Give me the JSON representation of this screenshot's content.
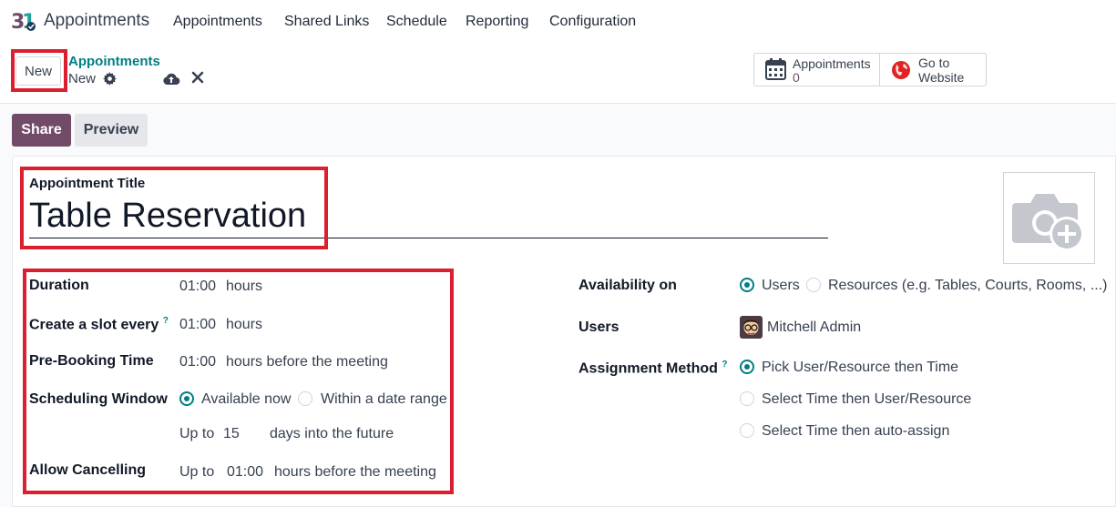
{
  "app": {
    "title": "Appointments"
  },
  "menu": [
    "Appointments",
    "Shared Links",
    "Schedule",
    "Reporting",
    "Configuration"
  ],
  "toolbar": {
    "new_label": "New",
    "breadcrumb_parent": "Appointments",
    "breadcrumb_current": "New"
  },
  "stats": {
    "appointments_label": "Appointments",
    "appointments_value": "0",
    "website_line1": "Go to",
    "website_line2": "Website"
  },
  "actions": {
    "share": "Share",
    "preview": "Preview"
  },
  "form": {
    "title_label": "Appointment Title",
    "title_value": "Table Reservation",
    "duration": {
      "label": "Duration",
      "value": "01:00",
      "unit": "hours"
    },
    "slot": {
      "label": "Create a slot every",
      "help": "?",
      "value": "01:00",
      "unit": "hours"
    },
    "prebook": {
      "label": "Pre-Booking Time",
      "value": "01:00",
      "unit": "hours before the meeting"
    },
    "window": {
      "label": "Scheduling Window",
      "opt1": "Available now",
      "opt2": "Within a date range",
      "upto": "Up to",
      "days": "15",
      "days_suffix": "days into the future"
    },
    "cancel": {
      "label": "Allow Cancelling",
      "upto": "Up to",
      "value": "01:00",
      "suffix": "hours before the meeting"
    },
    "availability": {
      "label": "Availability on",
      "opt1": "Users",
      "opt2": "Resources (e.g. Tables, Courts, Rooms, ...)"
    },
    "users": {
      "label": "Users",
      "value": "Mitchell Admin"
    },
    "assignment": {
      "label": "Assignment Method",
      "help": "?",
      "opt1": "Pick User/Resource then Time",
      "opt2": "Select Time then User/Resource",
      "opt3": "Select Time then auto-assign"
    }
  },
  "colors": {
    "brand": "#714b67",
    "accent": "#017e84",
    "highlight": "#dc1f2e"
  }
}
